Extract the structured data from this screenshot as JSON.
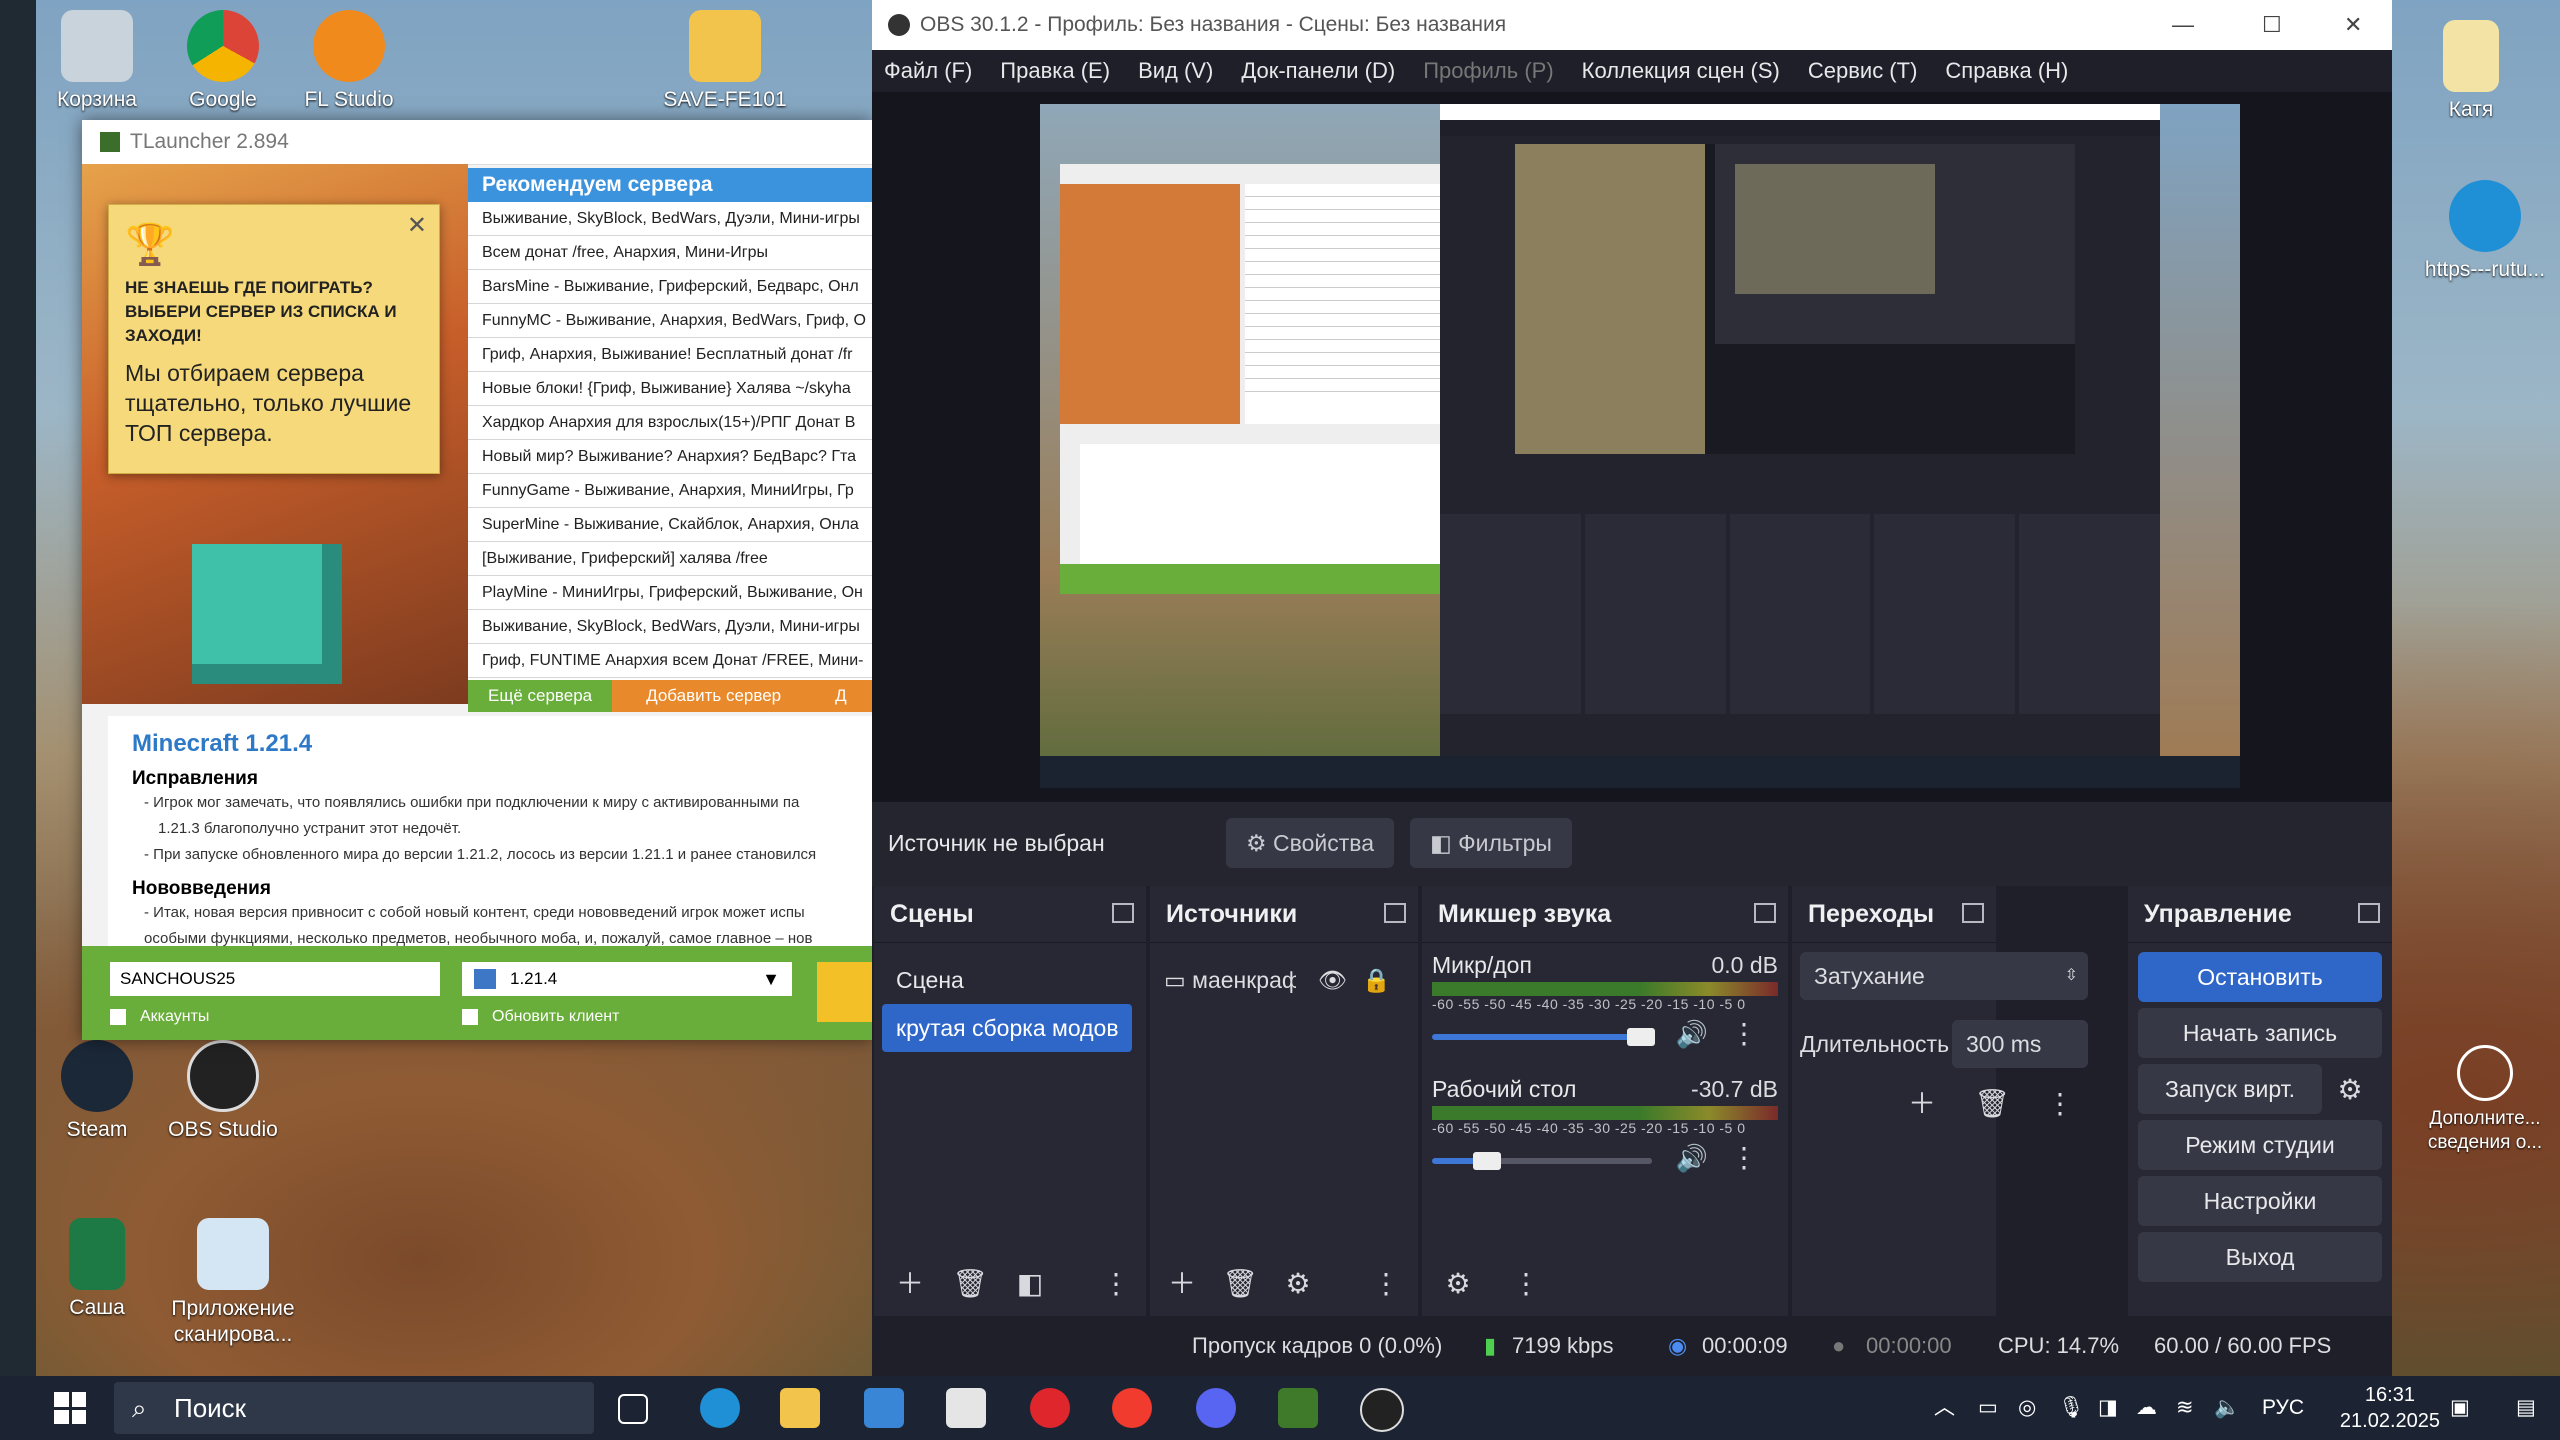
{
  "desktop": {
    "icons_top": [
      {
        "label": "Корзина"
      },
      {
        "label": "Google"
      },
      {
        "label": "FL Studio"
      },
      {
        "label": "SAVE-FE101"
      }
    ],
    "icons_right": [
      {
        "label": "Катя"
      },
      {
        "label": "https---rutu..."
      },
      {
        "label": "Дополните... сведения о..."
      }
    ],
    "icons_bottom": [
      {
        "label": "Steam"
      },
      {
        "label": "OBS Studio"
      },
      {
        "label": "Саша"
      },
      {
        "label": "Приложение сканирова..."
      }
    ]
  },
  "tlauncher": {
    "title": "TLauncher 2.894",
    "promo_caption": "НЕ ЗНАЕШЬ ГДЕ ПОИГРАТЬ? ВЫБЕРИ СЕРВЕР ИЗ СПИСКА И ЗАХОДИ!",
    "promo_text": "Мы отбираем сервера тщательно, только лучшие ТОП сервера.",
    "list_header": "Рекомендуем сервера",
    "servers": [
      "Выживание, SkyBlock, BedWars, Дуэли, Мини-игры",
      "Всем донат /free, Анархия, Мини-Игры",
      "BarsMine - Выживание, Гриферский, Бедварс, Онл",
      "FunnyMC - Выживание, Анархия, BedWars, Гриф, О",
      "Гриф, Анархия, Выживание! Бесплатный донат /fr",
      "Новые блоки! {Гриф, Выживание} Халява ~/skyha",
      "Хардкор Анархия для взрослых(15+)/PПГ Донат В",
      "Новый мир? Выживание? Анархия? БедВарс? Гта",
      "FunnyGame - Выживание, Анархия, МиниИгры, Гр",
      "SuperMine - Выживание, Скайблок, Анархия, Онла",
      "[Выживание, Гриферский] халява /free",
      "PlayMine - МиниИгры, Гриферский, Выживание, Он",
      "Выживание, SkyBlock, BedWars, Дуэли, Мини-игры",
      "Гриф, FUNTIME Анархия всем Донат /FREE, Мини-"
    ],
    "btn_more": "Ещё сервера",
    "btn_add": "Добавить сервер",
    "btn_cut": "Д",
    "news_title": "Minecraft 1.21.4",
    "news_fixes": "Исправления",
    "news_fix_lines": [
      "- Игрок мог замечать, что появлялись ошибки при подключении к миру с активированными па",
      "1.21.3 благополучно устранит этот недочёт.",
      "- При запуске обновленного мира до версии 1.21.2, лосось из версии 1.21.1 и ранее становился"
    ],
    "news_new": "Нововведения",
    "news_new_lines": [
      "- Итак, новая версия привносит с собой новый контент, среди нововведений игрок может испы",
      "особыми функциями, несколько предметов, необычного моба, и, пожалуй, самое главное – нов"
    ],
    "nickname": "SANCHOUS25",
    "version": "1.21.4",
    "chk_accounts": "Аккаунты",
    "chk_update": "Обновить клиент"
  },
  "obs": {
    "title": "OBS 30.1.2 - Профиль: Без названия - Сцены: Без названия",
    "menu": [
      "Файл (F)",
      "Правка (E)",
      "Вид (V)",
      "Док-панели (D)",
      "Профиль (P)",
      "Коллекция сцен (S)",
      "Сервис (T)",
      "Справка (H)"
    ],
    "no_source": "Источник не выбран",
    "btn_properties": "Свойства",
    "btn_filters": "Фильтры",
    "docks": {
      "scenes": "Сцены",
      "sources": "Источники",
      "mixer": "Микшер звука",
      "transitions": "Переходы между с...",
      "controls": "Управление"
    },
    "scenes": [
      "Сцена",
      "крутая сборка модов"
    ],
    "sources": [
      "маенкрафт"
    ],
    "mixer": [
      {
        "name": "Микр/доп",
        "db": "0.0 dB",
        "level": 0.95
      },
      {
        "name": "Рабочий стол",
        "db": "-30.7 dB",
        "level": 0.25
      }
    ],
    "meter_ticks": "-60 -55 -50 -45 -40 -35 -30 -25 -20 -15 -10 -5 0",
    "transition": "Затухание",
    "duration_label": "Длительность",
    "duration": "300 ms",
    "controls": [
      "Остановить трансляцию",
      "Начать запись",
      "Запуск вирт. камеры",
      "Режим студии",
      "Настройки",
      "Выход"
    ],
    "status": {
      "dropped": "Пропуск кадров 0 (0.0%)",
      "bitrate": "7199 kbps",
      "stream_time": "00:00:09",
      "rec_time": "00:00:00",
      "cpu": "CPU: 14.7%",
      "fps": "60.00 / 60.00 FPS"
    }
  },
  "taskbar": {
    "search": "Поиск",
    "lang": "РУС",
    "time": "16:31",
    "date": "21.02.2025"
  }
}
